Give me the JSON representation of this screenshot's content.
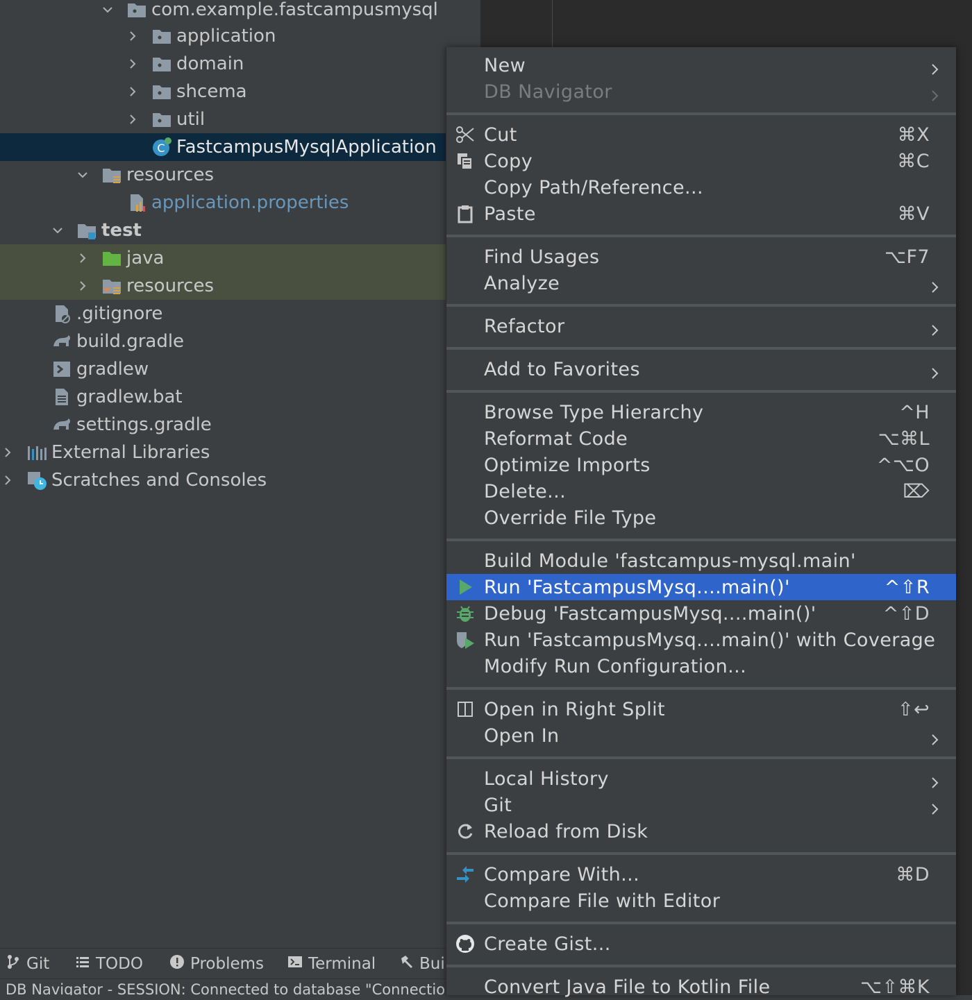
{
  "tree": {
    "items": [
      {
        "label": "com.example.fastcampusmysql"
      },
      {
        "label": "application"
      },
      {
        "label": "domain"
      },
      {
        "label": "shcema"
      },
      {
        "label": "util"
      },
      {
        "label": "FastcampusMysqlApplication"
      },
      {
        "label": "resources"
      },
      {
        "label": "application.properties"
      },
      {
        "label": "test"
      },
      {
        "label": "java"
      },
      {
        "label": "resources"
      },
      {
        "label": ".gitignore"
      },
      {
        "label": "build.gradle"
      },
      {
        "label": "gradlew"
      },
      {
        "label": "gradlew.bat"
      },
      {
        "label": "settings.gradle"
      },
      {
        "label": "External Libraries"
      },
      {
        "label": "Scratches and Consoles"
      }
    ]
  },
  "toolbar": {
    "git": "Git",
    "todo": "TODO",
    "problems": "Problems",
    "terminal": "Terminal",
    "build": "Bui"
  },
  "status": {
    "text": "DB Navigator - SESSION: Connected to database \"Connection"
  },
  "menu": {
    "items": [
      {
        "label": "New",
        "shortcut": ""
      },
      {
        "label": "DB Navigator",
        "shortcut": ""
      },
      {
        "label": "Cut",
        "shortcut": "⌘X"
      },
      {
        "label": "Copy",
        "shortcut": "⌘C"
      },
      {
        "label": "Copy Path/Reference...",
        "shortcut": ""
      },
      {
        "label": "Paste",
        "shortcut": "⌘V"
      },
      {
        "label": "Find Usages",
        "shortcut": "⌥F7"
      },
      {
        "label": "Analyze",
        "shortcut": ""
      },
      {
        "label": "Refactor",
        "shortcut": ""
      },
      {
        "label": "Add to Favorites",
        "shortcut": ""
      },
      {
        "label": "Browse Type Hierarchy",
        "shortcut": "^H"
      },
      {
        "label": "Reformat Code",
        "shortcut": "⌥⌘L"
      },
      {
        "label": "Optimize Imports",
        "shortcut": "^⌥O"
      },
      {
        "label": "Delete...",
        "shortcut": "⌦"
      },
      {
        "label": "Override File Type",
        "shortcut": ""
      },
      {
        "label": "Build Module 'fastcampus-mysql.main'",
        "shortcut": ""
      },
      {
        "label": "Run 'FastcampusMysq....main()'",
        "shortcut": "^⇧R"
      },
      {
        "label": "Debug 'FastcampusMysq....main()'",
        "shortcut": "^⇧D"
      },
      {
        "label": "Run 'FastcampusMysq....main()' with Coverage",
        "shortcut": ""
      },
      {
        "label": "Modify Run Configuration...",
        "shortcut": ""
      },
      {
        "label": "Open in Right Split",
        "shortcut": "⇧↩"
      },
      {
        "label": "Open In",
        "shortcut": ""
      },
      {
        "label": "Local History",
        "shortcut": ""
      },
      {
        "label": "Git",
        "shortcut": ""
      },
      {
        "label": "Reload from Disk",
        "shortcut": ""
      },
      {
        "label": "Compare With...",
        "shortcut": "⌘D"
      },
      {
        "label": "Compare File with Editor",
        "shortcut": ""
      },
      {
        "label": "Create Gist...",
        "shortcut": ""
      },
      {
        "label": "Convert Java File to Kotlin File",
        "shortcut": "⌥⇧⌘K"
      }
    ]
  },
  "colors": {
    "background": "#3c3f41",
    "selection": "#0d293e",
    "menu_active": "#2f65ca",
    "run_green": "#59a869",
    "link_blue": "#6897bb"
  }
}
